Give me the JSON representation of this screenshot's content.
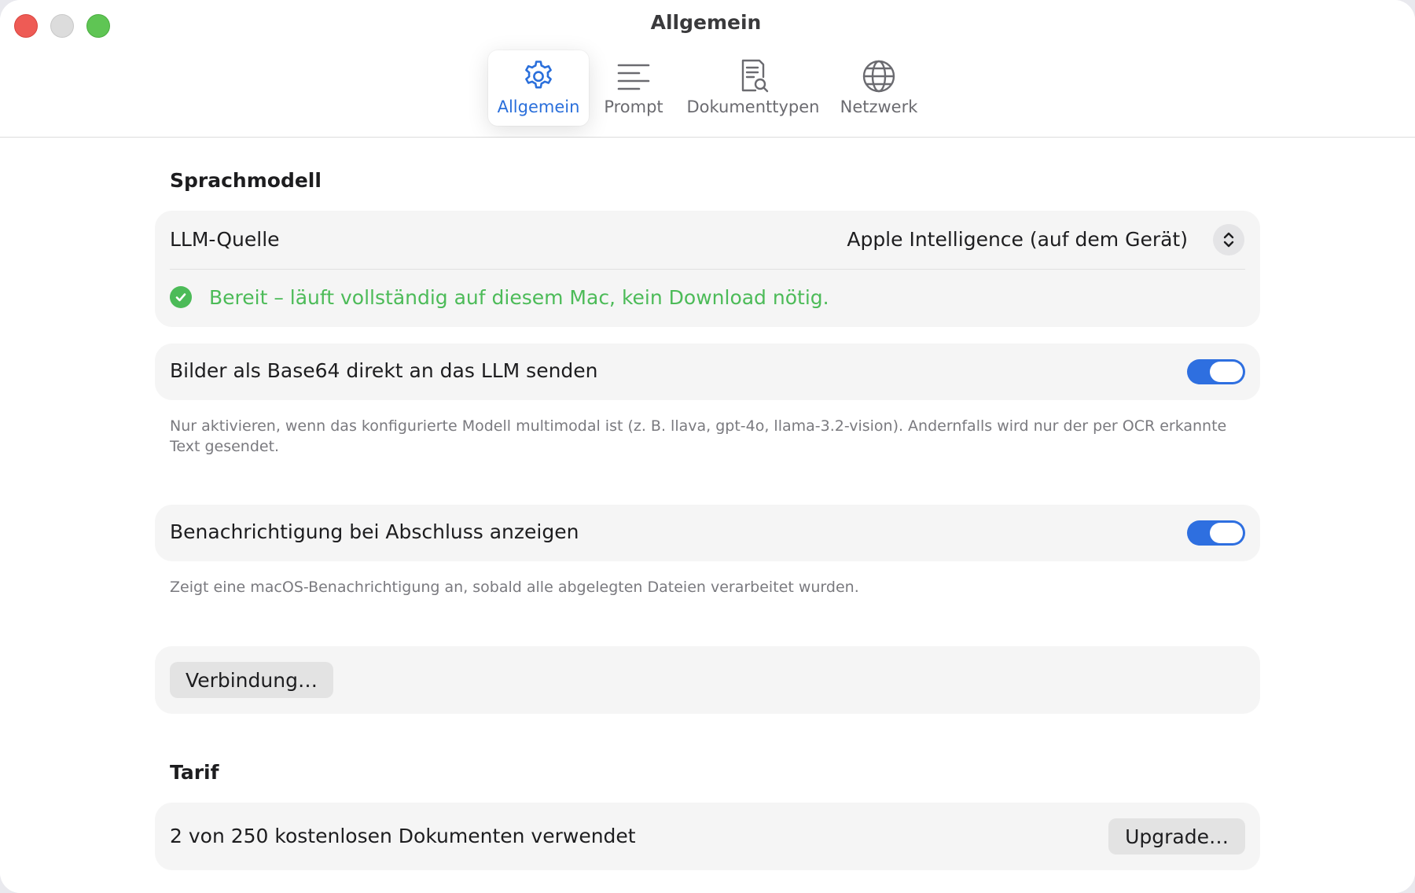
{
  "window": {
    "title": "Allgemein"
  },
  "toolbar": {
    "tabs": [
      {
        "label": "Allgemein",
        "icon": "gear-icon",
        "active": true
      },
      {
        "label": "Prompt",
        "icon": "text-lines-icon",
        "active": false
      },
      {
        "label": "Dokumenttypen",
        "icon": "document-search-icon",
        "active": false
      },
      {
        "label": "Netzwerk",
        "icon": "globe-icon",
        "active": false
      }
    ]
  },
  "sprachmodell": {
    "title": "Sprachmodell",
    "llm_source_label": "LLM-Quelle",
    "llm_source_value": "Apple Intelligence (auf dem Gerät)",
    "status_text": "Bereit – läuft vollständig auf diesem Mac, kein Download nötig."
  },
  "base64": {
    "label": "Bilder als Base64 direkt an das LLM senden",
    "enabled": true,
    "help": "Nur aktivieren, wenn das konfigurierte Modell multimodal ist (z. B. llava, gpt-4o, llama-3.2-vision). Andernfalls wird nur der per OCR erkannte Text gesendet."
  },
  "notification": {
    "label": "Benachrichtigung bei Abschluss anzeigen",
    "enabled": true,
    "help": "Zeigt eine macOS-Benachrichtigung an, sobald alle abgelegten Dateien verarbeitet wurden."
  },
  "connection": {
    "button_label": "Verbindung…"
  },
  "tarif": {
    "title": "Tarif",
    "usage_text": "2 von 250 kostenlosen Dokumenten verwendet",
    "upgrade_label": "Upgrade…"
  },
  "colors": {
    "accent": "#2e6fe0",
    "success": "#4cbb58",
    "card_bg": "#f5f5f5"
  }
}
